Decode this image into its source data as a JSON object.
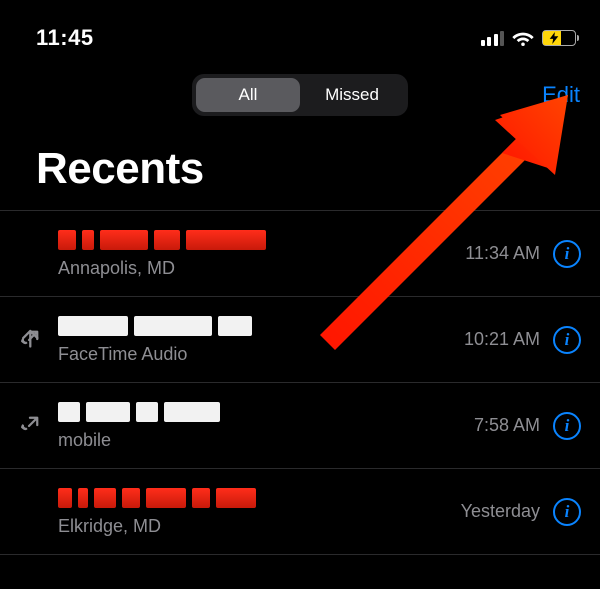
{
  "statusbar": {
    "time": "11:45"
  },
  "segmented": {
    "all": "All",
    "missed": "Missed",
    "active": "all"
  },
  "edit_label": "Edit",
  "page_title": "Recents",
  "colors": {
    "link": "#0a84ff",
    "missed": "#ff3b30",
    "secondary": "#8e8e93"
  },
  "calls": [
    {
      "outgoing": false,
      "missed": true,
      "subtext": "Annapolis, MD",
      "time": "11:34 AM"
    },
    {
      "outgoing": true,
      "missed": false,
      "subtext": "FaceTime Audio",
      "time": "10:21 AM"
    },
    {
      "outgoing": true,
      "missed": false,
      "subtext": "mobile",
      "time": "7:58 AM"
    },
    {
      "outgoing": false,
      "missed": true,
      "subtext": "Elkridge, MD",
      "time": "Yesterday"
    }
  ],
  "annotation": {
    "type": "arrow",
    "points_to": "edit-button",
    "color": "#ff2d00"
  }
}
